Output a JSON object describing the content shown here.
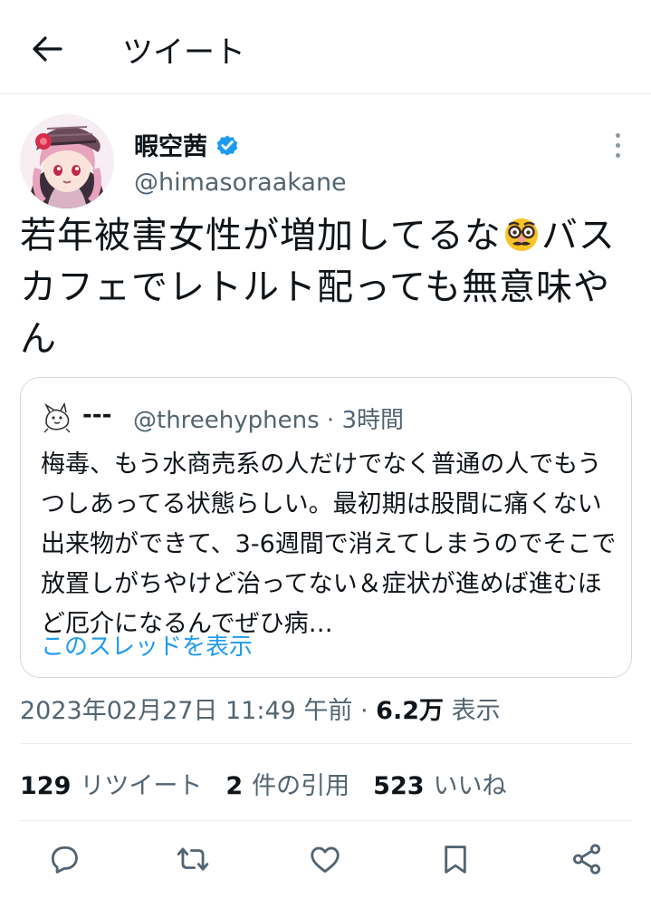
{
  "header": {
    "title": "ツイート",
    "back_icon": "arrow-left-icon"
  },
  "author": {
    "display_name": "暇空茜",
    "handle": "@himasoraakane",
    "verified_color": "#1d9bf0"
  },
  "tweet": {
    "text_part1": "若年被害女性が増加してるな",
    "emoji": "disguised-face-emoji",
    "text_part2": "バスカフェでレトルト配っても無意味やん"
  },
  "quote": {
    "name": "---",
    "handle": "@threehyphens · 3時間",
    "text": "梅毒、もう水商売系の人だけでなく普通の人でもうつしあってる状態らしい。最初期は股間に痛くない出来物ができて、3-6週間で消えてしまうのでそこで放置しがちやけど治ってない＆症状が進めば進むほど厄介になるんでぜひ病…",
    "show_thread": "このスレッドを表示"
  },
  "meta": {
    "datetime": "2023年02月27日 11:49 午前 · ",
    "views_count": "6.2万",
    "views_label": " 表示"
  },
  "stats": {
    "retweets_count": "129",
    "retweets_label": "リツイート",
    "quotes_count": "2",
    "quotes_label": "件の引用",
    "likes_count": "523",
    "likes_label": "いいね"
  },
  "colors": {
    "accent": "#1d9bf0",
    "text": "#0f1419",
    "secondary": "#536471",
    "border": "#cfd9de"
  }
}
